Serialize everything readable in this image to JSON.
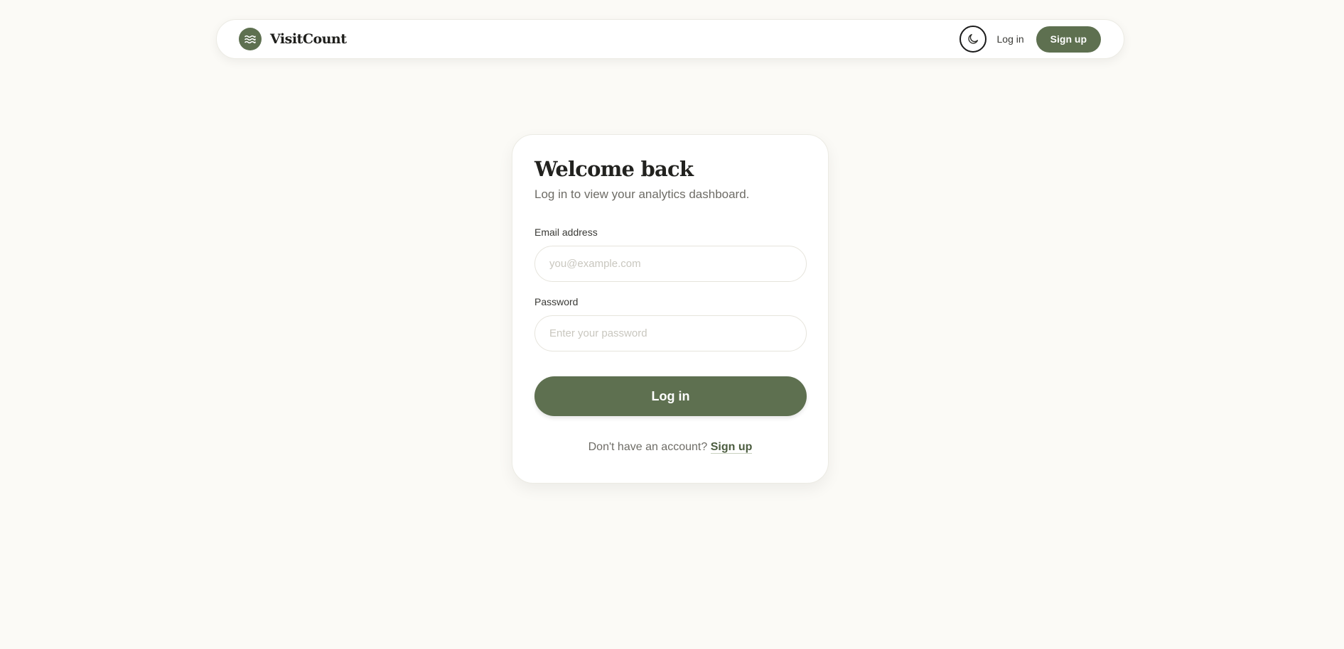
{
  "colors": {
    "background": "#fbfaf6",
    "accent": "#5e7050",
    "card": "#ffffff"
  },
  "header": {
    "brand_name": "VisitCount",
    "logo_icon": "waves-icon",
    "theme_toggle_icon": "moon-icon",
    "login_label": "Log in",
    "signup_label": "Sign up"
  },
  "login_card": {
    "title": "Welcome back",
    "subtitle": "Log in to view your analytics dashboard.",
    "email": {
      "label": "Email address",
      "placeholder": "you@example.com",
      "value": ""
    },
    "password": {
      "label": "Password",
      "placeholder": "Enter your password",
      "value": ""
    },
    "submit_label": "Log in",
    "signup_prompt": "Don't have an account?",
    "signup_link": "Sign up"
  }
}
